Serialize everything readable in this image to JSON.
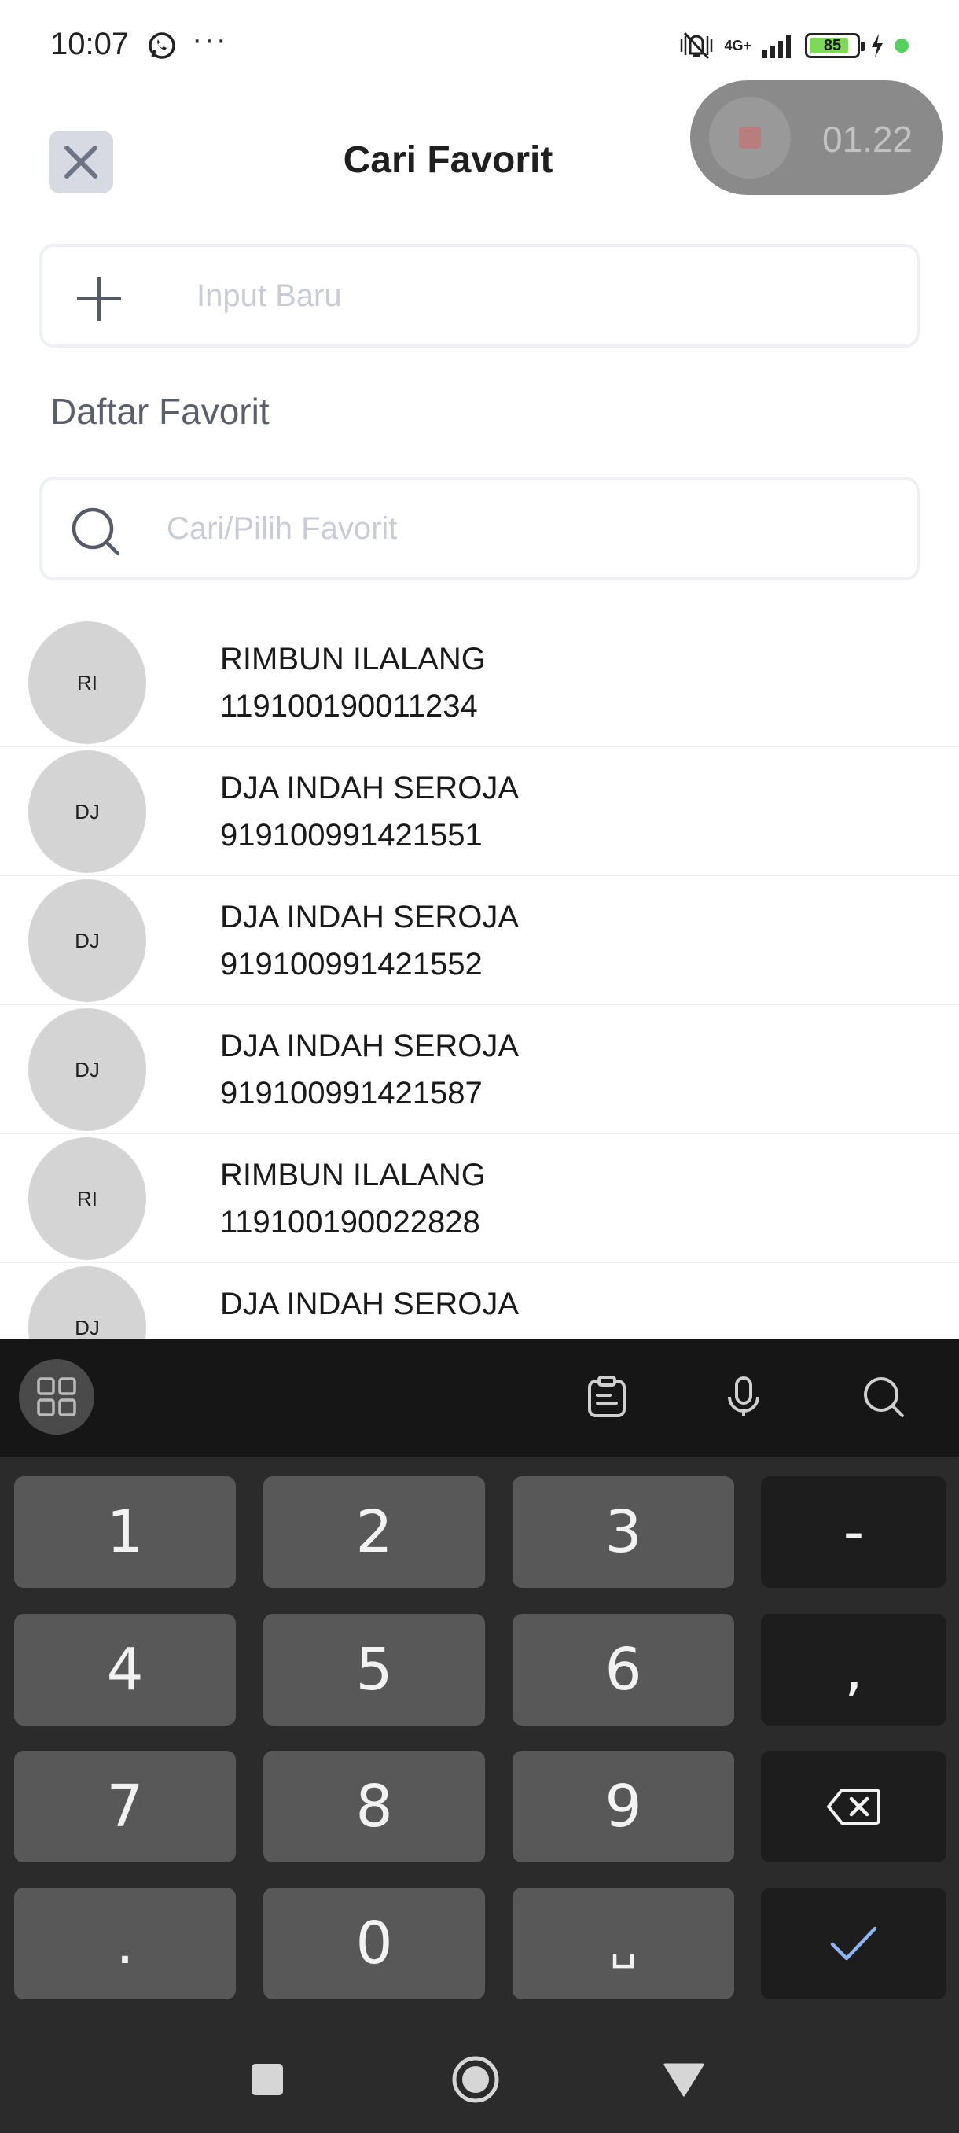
{
  "status_bar": {
    "time": "10:07",
    "more": "···",
    "network": "4G+",
    "battery": "85",
    "battery_level": 0.85,
    "icons": [
      "whatsapp-icon",
      "mute-icon",
      "signal-icon",
      "battery-icon",
      "charging-icon"
    ]
  },
  "recorder": {
    "time": "01.22"
  },
  "header": {
    "title": "Cari Favorit",
    "close_icon": "close-icon"
  },
  "new_input": {
    "placeholder": "Input Baru",
    "icon": "plus-icon"
  },
  "section": {
    "title": "Daftar Favorit"
  },
  "search": {
    "placeholder": "Cari/Pilih Favorit",
    "icon": "search-icon"
  },
  "favorites": [
    {
      "initials": "RI",
      "name": "RIMBUN ILALANG",
      "account": "119100190011234"
    },
    {
      "initials": "DJ",
      "name": "DJA INDAH SEROJA",
      "account": "919100991421551"
    },
    {
      "initials": "DJ",
      "name": "DJA INDAH SEROJA",
      "account": "919100991421552"
    },
    {
      "initials": "DJ",
      "name": "DJA INDAH SEROJA",
      "account": "919100991421587"
    },
    {
      "initials": "RI",
      "name": "RIMBUN ILALANG",
      "account": "119100190022828"
    },
    {
      "initials": "DJ",
      "name": "DJA INDAH SEROJA",
      "account": ""
    }
  ],
  "keyboard": {
    "toolbar": [
      "apps-grid-icon",
      "clipboard-icon",
      "mic-icon",
      "search-icon"
    ],
    "keys": {
      "k1": "1",
      "k2": "2",
      "k3": "3",
      "minus": "-",
      "k4": "4",
      "k5": "5",
      "k6": "6",
      "comma": ",",
      "k7": "7",
      "k8": "8",
      "k9": "9",
      "dot": ".",
      "k0": "0",
      "space": "␣"
    },
    "accent": "#8fb4f2"
  },
  "nav": [
    "recent-apps-icon",
    "home-icon",
    "back-icon"
  ]
}
